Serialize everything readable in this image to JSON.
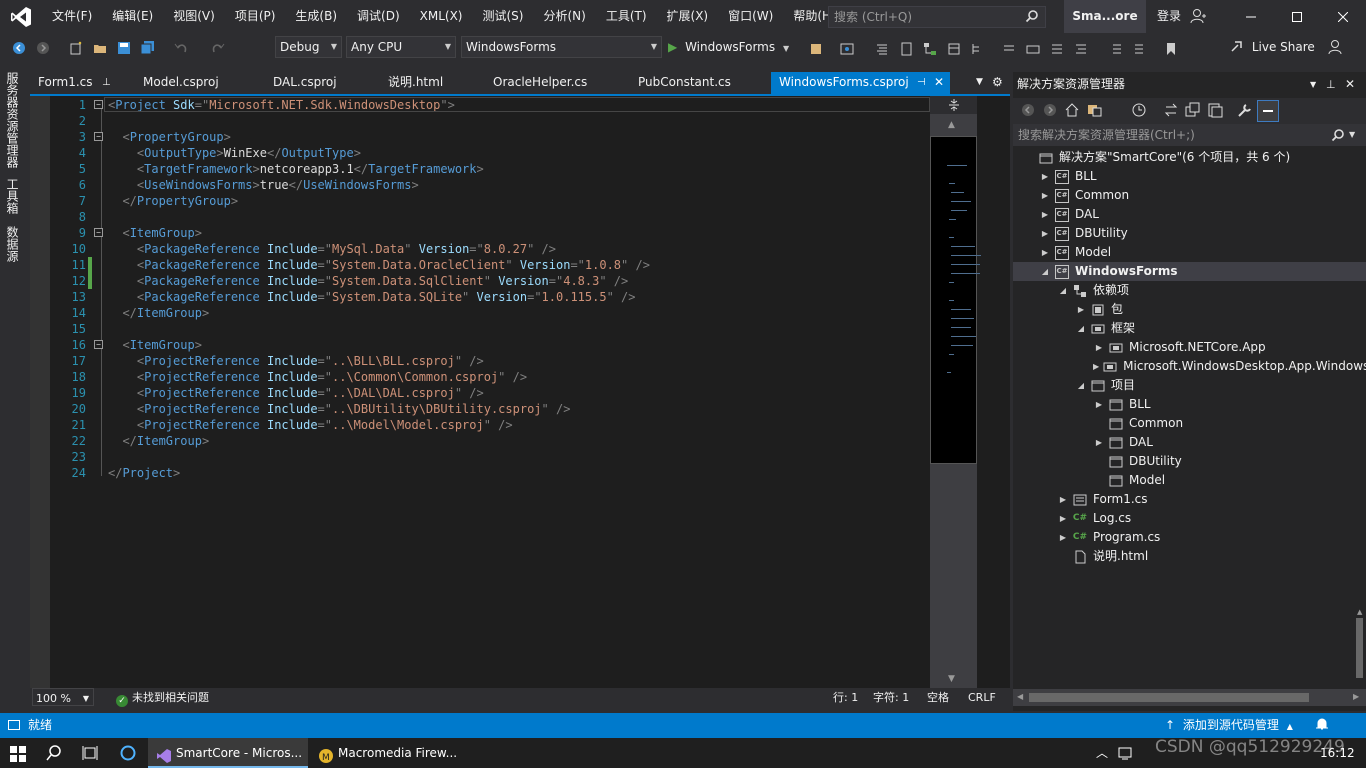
{
  "window": {
    "menu": [
      "文件(F)",
      "编辑(E)",
      "视图(V)",
      "项目(P)",
      "生成(B)",
      "调试(D)",
      "XML(X)",
      "测试(S)",
      "分析(N)",
      "工具(T)",
      "扩展(X)",
      "窗口(W)",
      "帮助(H)"
    ],
    "search_placeholder": "搜索 (Ctrl+Q)",
    "solution_name": "Sma...ore",
    "login": "登录"
  },
  "toolbar": {
    "config": "Debug",
    "platform": "Any CPU",
    "startup_project": "WindowsForms",
    "start_label": "WindowsForms",
    "live_share": "Live Share"
  },
  "side_tabs": [
    "服务器资源管理器",
    "工具箱",
    "数据源"
  ],
  "doc_tabs": [
    {
      "label": "Form1.cs",
      "active": false
    },
    {
      "label": "Model.csproj",
      "active": false
    },
    {
      "label": "DAL.csproj",
      "active": false
    },
    {
      "label": "说明.html",
      "active": false
    },
    {
      "label": "OracleHelper.cs",
      "active": false
    },
    {
      "label": "PubConstant.cs",
      "active": false
    },
    {
      "label": "WindowsForms.csproj",
      "active": true
    }
  ],
  "code_lines": [
    [
      [
        "br",
        "<"
      ],
      [
        "tag",
        "Project"
      ],
      [
        "txt",
        " "
      ],
      [
        "attr",
        "Sdk"
      ],
      [
        "br",
        "=\""
      ],
      [
        "val",
        "Microsoft.NET.Sdk.WindowsDesktop"
      ],
      [
        "br",
        "\">"
      ]
    ],
    [],
    [
      [
        "txt",
        "  "
      ],
      [
        "br",
        "<"
      ],
      [
        "tag",
        "PropertyGroup"
      ],
      [
        "br",
        ">"
      ]
    ],
    [
      [
        "txt",
        "    "
      ],
      [
        "br",
        "<"
      ],
      [
        "tag",
        "OutputType"
      ],
      [
        "br",
        ">"
      ],
      [
        "txt",
        "WinExe"
      ],
      [
        "br",
        "</"
      ],
      [
        "tag",
        "OutputType"
      ],
      [
        "br",
        ">"
      ]
    ],
    [
      [
        "txt",
        "    "
      ],
      [
        "br",
        "<"
      ],
      [
        "tag",
        "TargetFramework"
      ],
      [
        "br",
        ">"
      ],
      [
        "txt",
        "netcoreapp3.1"
      ],
      [
        "br",
        "</"
      ],
      [
        "tag",
        "TargetFramework"
      ],
      [
        "br",
        ">"
      ]
    ],
    [
      [
        "txt",
        "    "
      ],
      [
        "br",
        "<"
      ],
      [
        "tag",
        "UseWindowsForms"
      ],
      [
        "br",
        ">"
      ],
      [
        "txt",
        "true"
      ],
      [
        "br",
        "</"
      ],
      [
        "tag",
        "UseWindowsForms"
      ],
      [
        "br",
        ">"
      ]
    ],
    [
      [
        "txt",
        "  "
      ],
      [
        "br",
        "</"
      ],
      [
        "tag",
        "PropertyGroup"
      ],
      [
        "br",
        ">"
      ]
    ],
    [],
    [
      [
        "txt",
        "  "
      ],
      [
        "br",
        "<"
      ],
      [
        "tag",
        "ItemGroup"
      ],
      [
        "br",
        ">"
      ]
    ],
    [
      [
        "txt",
        "    "
      ],
      [
        "br",
        "<"
      ],
      [
        "tag",
        "PackageReference"
      ],
      [
        "txt",
        " "
      ],
      [
        "attr",
        "Include"
      ],
      [
        "br",
        "=\""
      ],
      [
        "val",
        "MySql.Data"
      ],
      [
        "br",
        "\""
      ],
      [
        "txt",
        " "
      ],
      [
        "attr",
        "Version"
      ],
      [
        "br",
        "=\""
      ],
      [
        "val",
        "8.0.27"
      ],
      [
        "br",
        "\" />"
      ]
    ],
    [
      [
        "txt",
        "    "
      ],
      [
        "br",
        "<"
      ],
      [
        "tag",
        "PackageReference"
      ],
      [
        "txt",
        " "
      ],
      [
        "attr",
        "Include"
      ],
      [
        "br",
        "=\""
      ],
      [
        "val",
        "System.Data.OracleClient"
      ],
      [
        "br",
        "\""
      ],
      [
        "txt",
        " "
      ],
      [
        "attr",
        "Version"
      ],
      [
        "br",
        "=\""
      ],
      [
        "val",
        "1.0.8"
      ],
      [
        "br",
        "\" />"
      ]
    ],
    [
      [
        "txt",
        "    "
      ],
      [
        "br",
        "<"
      ],
      [
        "tag",
        "PackageReference"
      ],
      [
        "txt",
        " "
      ],
      [
        "attr",
        "Include"
      ],
      [
        "br",
        "=\""
      ],
      [
        "val",
        "System.Data.SqlClient"
      ],
      [
        "br",
        "\""
      ],
      [
        "txt",
        " "
      ],
      [
        "attr",
        "Version"
      ],
      [
        "br",
        "=\""
      ],
      [
        "val",
        "4.8.3"
      ],
      [
        "br",
        "\" />"
      ]
    ],
    [
      [
        "txt",
        "    "
      ],
      [
        "br",
        "<"
      ],
      [
        "tag",
        "PackageReference"
      ],
      [
        "txt",
        " "
      ],
      [
        "attr",
        "Include"
      ],
      [
        "br",
        "=\""
      ],
      [
        "val",
        "System.Data.SQLite"
      ],
      [
        "br",
        "\""
      ],
      [
        "txt",
        " "
      ],
      [
        "attr",
        "Version"
      ],
      [
        "br",
        "=\""
      ],
      [
        "val",
        "1.0.115.5"
      ],
      [
        "br",
        "\" />"
      ]
    ],
    [
      [
        "txt",
        "  "
      ],
      [
        "br",
        "</"
      ],
      [
        "tag",
        "ItemGroup"
      ],
      [
        "br",
        ">"
      ]
    ],
    [],
    [
      [
        "txt",
        "  "
      ],
      [
        "br",
        "<"
      ],
      [
        "tag",
        "ItemGroup"
      ],
      [
        "br",
        ">"
      ]
    ],
    [
      [
        "txt",
        "    "
      ],
      [
        "br",
        "<"
      ],
      [
        "tag",
        "ProjectReference"
      ],
      [
        "txt",
        " "
      ],
      [
        "attr",
        "Include"
      ],
      [
        "br",
        "=\""
      ],
      [
        "val",
        "..\\BLL\\BLL.csproj"
      ],
      [
        "br",
        "\" />"
      ]
    ],
    [
      [
        "txt",
        "    "
      ],
      [
        "br",
        "<"
      ],
      [
        "tag",
        "ProjectReference"
      ],
      [
        "txt",
        " "
      ],
      [
        "attr",
        "Include"
      ],
      [
        "br",
        "=\""
      ],
      [
        "val",
        "..\\Common\\Common.csproj"
      ],
      [
        "br",
        "\" />"
      ]
    ],
    [
      [
        "txt",
        "    "
      ],
      [
        "br",
        "<"
      ],
      [
        "tag",
        "ProjectReference"
      ],
      [
        "txt",
        " "
      ],
      [
        "attr",
        "Include"
      ],
      [
        "br",
        "=\""
      ],
      [
        "val",
        "..\\DAL\\DAL.csproj"
      ],
      [
        "br",
        "\" />"
      ]
    ],
    [
      [
        "txt",
        "    "
      ],
      [
        "br",
        "<"
      ],
      [
        "tag",
        "ProjectReference"
      ],
      [
        "txt",
        " "
      ],
      [
        "attr",
        "Include"
      ],
      [
        "br",
        "=\""
      ],
      [
        "val",
        "..\\DBUtility\\DBUtility.csproj"
      ],
      [
        "br",
        "\" />"
      ]
    ],
    [
      [
        "txt",
        "    "
      ],
      [
        "br",
        "<"
      ],
      [
        "tag",
        "ProjectReference"
      ],
      [
        "txt",
        " "
      ],
      [
        "attr",
        "Include"
      ],
      [
        "br",
        "=\""
      ],
      [
        "val",
        "..\\Model\\Model.csproj"
      ],
      [
        "br",
        "\" />"
      ]
    ],
    [
      [
        "txt",
        "  "
      ],
      [
        "br",
        "</"
      ],
      [
        "tag",
        "ItemGroup"
      ],
      [
        "br",
        ">"
      ]
    ],
    [],
    [
      [
        "br",
        "</"
      ],
      [
        "tag",
        "Project"
      ],
      [
        "br",
        ">"
      ]
    ]
  ],
  "folds": [
    1,
    3,
    9,
    16
  ],
  "changed_lines": [
    11,
    12
  ],
  "editor_status": {
    "zoom": "100 %",
    "issues": "未找到相关问题",
    "line": "行: 1",
    "col": "字符: 1",
    "ws": "空格",
    "eol": "CRLF"
  },
  "solution_explorer": {
    "title": "解决方案资源管理器",
    "search_placeholder": "搜索解决方案资源管理器(Ctrl+;)",
    "tree": [
      {
        "label": "解决方案\"SmartCore\"(6 个项目，共 6 个)",
        "depth": 0,
        "exp": "",
        "icon": "solution"
      },
      {
        "label": "BLL",
        "depth": 1,
        "exp": "right",
        "icon": "csproj"
      },
      {
        "label": "Common",
        "depth": 1,
        "exp": "right",
        "icon": "csproj"
      },
      {
        "label": "DAL",
        "depth": 1,
        "exp": "right",
        "icon": "csproj"
      },
      {
        "label": "DBUtility",
        "depth": 1,
        "exp": "right",
        "icon": "csproj"
      },
      {
        "label": "Model",
        "depth": 1,
        "exp": "right",
        "icon": "csproj"
      },
      {
        "label": "WindowsForms",
        "depth": 1,
        "exp": "down",
        "icon": "csproj",
        "selected": true
      },
      {
        "label": "依赖项",
        "depth": 2,
        "exp": "down",
        "icon": "deps"
      },
      {
        "label": "包",
        "depth": 3,
        "exp": "right",
        "icon": "package"
      },
      {
        "label": "框架",
        "depth": 3,
        "exp": "down",
        "icon": "framework"
      },
      {
        "label": "Microsoft.NETCore.App",
        "depth": 4,
        "exp": "right",
        "icon": "framework"
      },
      {
        "label": "Microsoft.WindowsDesktop.App.Windows",
        "depth": 4,
        "exp": "right",
        "icon": "framework"
      },
      {
        "label": "项目",
        "depth": 3,
        "exp": "down",
        "icon": "projects"
      },
      {
        "label": "BLL",
        "depth": 4,
        "exp": "right",
        "icon": "projects"
      },
      {
        "label": "Common",
        "depth": 4,
        "exp": "",
        "icon": "projects"
      },
      {
        "label": "DAL",
        "depth": 4,
        "exp": "right",
        "icon": "projects"
      },
      {
        "label": "DBUtility",
        "depth": 4,
        "exp": "",
        "icon": "projects"
      },
      {
        "label": "Model",
        "depth": 4,
        "exp": "",
        "icon": "projects"
      },
      {
        "label": "Form1.cs",
        "depth": 2,
        "exp": "right",
        "icon": "form"
      },
      {
        "label": "Log.cs",
        "depth": 2,
        "exp": "right",
        "icon": "csfile"
      },
      {
        "label": "Program.cs",
        "depth": 2,
        "exp": "right",
        "icon": "csfile"
      },
      {
        "label": "说明.html",
        "depth": 2,
        "exp": "",
        "icon": "html"
      }
    ]
  },
  "statusbar": {
    "text": "就绪",
    "add_source": "添加到源代码管理"
  },
  "taskbar": {
    "apps": [
      {
        "label": "SmartCore - Micros...",
        "active": true
      },
      {
        "label": "Macromedia Firew...",
        "active": false
      }
    ],
    "watermark": "CSDN @qq512929249",
    "clock": "16:12"
  },
  "colors": {
    "accent": "#007acc",
    "bg": "#2d2d30",
    "editor_bg": "#1e1e1e",
    "tag": "#569cd6",
    "attr": "#9cdcfe",
    "value": "#ce9178"
  }
}
